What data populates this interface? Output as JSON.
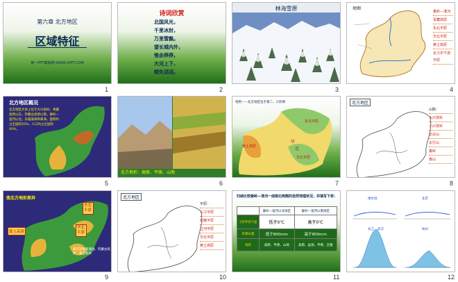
{
  "slides": [
    {
      "num": "1",
      "chapter": "第六章 北方地区",
      "main": "区域特征",
      "footer": "第一PPT模板网-WWW.1PPT.COM"
    },
    {
      "num": "2",
      "poem_title": "诗词欣赏",
      "lines": [
        "北国风光，",
        "千里冰封，",
        "万里雪飘。",
        "望长城内外，",
        "惟余莽莽，",
        "大河上下，",
        "顿失滔滔。"
      ]
    },
    {
      "num": "3",
      "title": "林海雪原"
    },
    {
      "num": "4",
      "labels": [
        "秦岭—淮河",
        "青藏高原",
        "东北平原",
        "华北平原",
        "黄土高原",
        "长江中下游平原"
      ]
    },
    {
      "num": "5",
      "title": "北方地区概况",
      "text": "北方地区大体上位于大兴安岭、青藏高原以东，内蒙古高原以南，秦岭—淮河以北，东临渤海和黄海，面积约占全国的20%，人口约占全国的40%。"
    },
    {
      "num": "6",
      "caption": "北方地形：高原、平原、山地"
    },
    {
      "num": "7",
      "header": "地势——北方地区位于第二、三阶梯",
      "regions": [
        "华",
        "北",
        "黄土高原",
        "东北平原",
        "华北平原"
      ]
    },
    {
      "num": "8",
      "title": "北方地区",
      "side_title": "山脉：",
      "side_items": [
        "大兴安岭",
        "小兴安岭",
        "长白山",
        "太行山",
        "秦岭",
        "泰山"
      ]
    },
    {
      "num": "9",
      "title": "南北方地形差异",
      "labels": [
        "东北平原",
        "华北平原",
        "黄土高原"
      ],
      "note": "黄河流经着湖泊、内蒙古高原、黄土高原"
    },
    {
      "num": "10",
      "title": "北方地区",
      "side_title": "平原：",
      "side_items": [
        "三江平原",
        "松嫩平原",
        "辽河平原",
        "华北平原",
        "黄土高原"
      ]
    },
    {
      "num": "11",
      "intro": "归纳比较秦岭—淮河一线南北两侧的自然地理状况，并填写下表：",
      "highlight": "秦岭—淮河",
      "headers": [
        "",
        "秦岭—淮河以北地区",
        "秦岭—淮河以南地区"
      ],
      "rows": [
        [
          "1月平均气温",
          "低于0℃",
          "高于0℃"
        ],
        [
          "年降水量",
          "低于800mm",
          "高于800mm"
        ],
        [
          "地形",
          "高原、平原、山地",
          "高原、盆地、平原、丘陵"
        ]
      ]
    },
    {
      "num": "12",
      "chart_labels": [
        "哈尔滨",
        "北京",
        "长江",
        "武汉",
        "杭州"
      ]
    }
  ]
}
